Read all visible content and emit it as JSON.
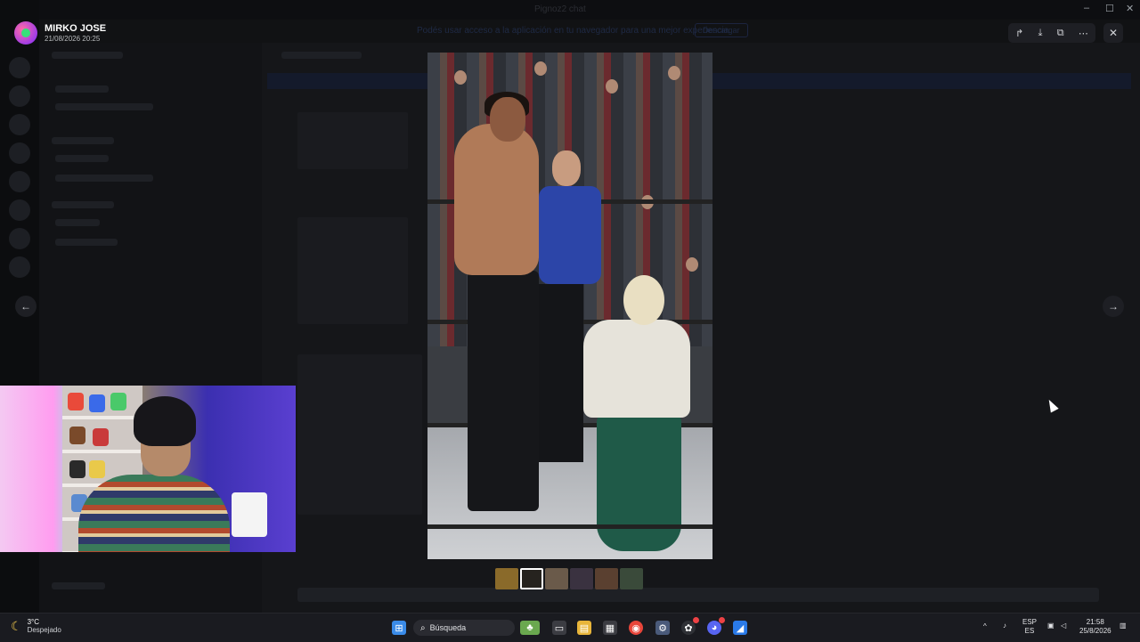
{
  "window": {
    "title": "Pignoz2 chat",
    "notice": "Podés usar acceso a la aplicación en tu navegador para una mejor experiencia.",
    "notice_button": "Descargar"
  },
  "viewer": {
    "author_name": "MIRKO JOSE",
    "author_date": "21/08/2026 20:25",
    "toolbar": {
      "share": "share-icon",
      "download": "download-icon",
      "open_external": "open-external-icon",
      "more": "more-icon"
    },
    "close": "✕",
    "prev": "←",
    "next": "→",
    "thumbnails": [
      {
        "color": "#8a6a2a",
        "active": false
      },
      {
        "color": "#26231f",
        "active": true
      },
      {
        "color": "#6a5a4a",
        "active": false
      },
      {
        "color": "#3a3240",
        "active": false
      },
      {
        "color": "#5a4030",
        "active": false
      },
      {
        "color": "#3a4a3a",
        "active": false
      }
    ]
  },
  "taskbar": {
    "weather_temp": "3°C",
    "weather_desc": "Despejado",
    "search_label": "Búsqueda",
    "lang_top": "ESP",
    "lang_bottom": "ES",
    "time": "21:58",
    "date": "25/8/2026"
  },
  "colors": {
    "accent": "#5865f2",
    "badge": "#ed4245"
  }
}
